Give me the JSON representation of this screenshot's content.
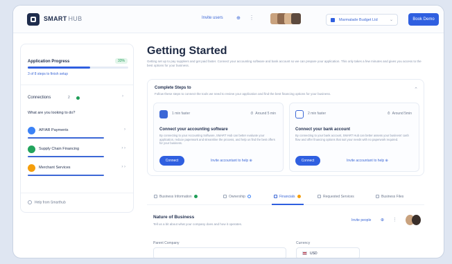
{
  "topbar": {
    "brand": "SMART",
    "brand_suffix": "HUB",
    "invite_label": "Invite users",
    "company_name": "Marmalade Budget Ltd",
    "primary_button": "Book Demo"
  },
  "sidebar": {
    "progress_title": "Application Progress",
    "progress_percent": "33%",
    "progress_fraction": 0.62,
    "progress_link": "3 of 8 steps to finish setup",
    "connections_label": "Connections",
    "connections_count": "2",
    "looking_for": "What are you looking to do?",
    "items": [
      {
        "label": "AP/AR Payments",
        "color": "#3b82f6",
        "extra": "›"
      },
      {
        "label": "Supply Chain Financing",
        "color": "#22a45d",
        "extra": "›  ›"
      },
      {
        "label": "Merchant Services",
        "color": "#f59e0b",
        "extra": "›  ›"
      }
    ],
    "help": "Help from Smarthub"
  },
  "main": {
    "title": "Getting Started",
    "description": "Getting set up to pay suppliers and get paid faster. Connect your accounting software and bank account so we can prepare your application. This only takes a few minutes and gives you access to the best options for your business.",
    "complete_card": {
      "title": "Complete Steps to",
      "subtitle": "Follow these steps to connect the tools we need to review your application and find the best financing options for your business.",
      "tasks": [
        {
          "step": "1 min faster",
          "time": "Around 5 min",
          "title": "Connect your accounting software",
          "desc": "By connecting to your Accounting Software, SMART Hub can better evaluate your application, reduce paperwork and streamline the process, and help us find the best offers for your business.",
          "button": "Connect",
          "link": "Invite accountant to help",
          "icon_color": "#3b67d6"
        },
        {
          "step": "2 min faster",
          "time": "Around 5min",
          "title": "Connect your bank account",
          "desc": "By connecting to your bank account, SMART Hub can better assess your business' cash flow and offer financing options that suit your needs with no paperwork required.",
          "button": "Connect",
          "link": "Invite accountant to help",
          "icon_color": "#3b67d6"
        }
      ]
    },
    "tabs": [
      {
        "label": "Business Information",
        "badge": "#1f9d57"
      },
      {
        "label": "Ownership",
        "badge": "#3b82f6"
      },
      {
        "label": "Financials",
        "badge": "#f59e0b"
      },
      {
        "label": "Requested Services",
        "badge": ""
      },
      {
        "label": "Business Files",
        "badge": ""
      }
    ],
    "nature": {
      "title": "Nature of Business",
      "subtitle": "Tell us a bit about what your company does and how it operates.",
      "invite_label": "Invite people"
    },
    "fields": {
      "parent_company_label": "Parent Company",
      "currency_label": "Currency",
      "currency_value": "USD"
    }
  }
}
